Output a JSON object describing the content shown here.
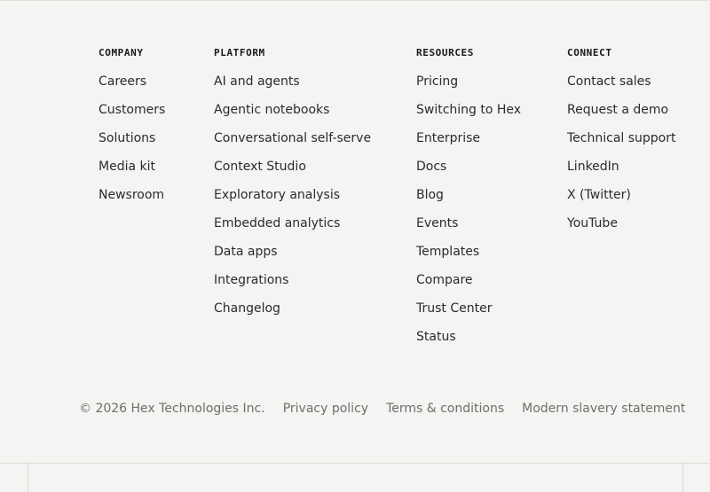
{
  "footer": {
    "columns": [
      {
        "heading": "COMPANY",
        "links": [
          "Careers",
          "Customers",
          "Solutions",
          "Media kit",
          "Newsroom"
        ]
      },
      {
        "heading": "PLATFORM",
        "links": [
          "AI and agents",
          "Agentic notebooks",
          "Conversational self-serve",
          "Context Studio",
          "Exploratory analysis",
          "Embedded analytics",
          "Data apps",
          "Integrations",
          "Changelog"
        ]
      },
      {
        "heading": "RESOURCES",
        "links": [
          "Pricing",
          "Switching to Hex",
          "Enterprise",
          "Docs",
          "Blog",
          "Events",
          "Templates",
          "Compare",
          "Trust Center",
          "Status"
        ]
      },
      {
        "heading": "CONNECT",
        "links": [
          "Contact sales",
          "Request a demo",
          "Technical support",
          "LinkedIn",
          "X (Twitter)",
          "YouTube"
        ]
      }
    ],
    "legal": {
      "copyright": "© 2026 Hex Technologies Inc.",
      "privacy": "Privacy policy",
      "terms": "Terms & conditions",
      "slavery": "Modern slavery statement"
    }
  },
  "colors": {
    "background": "#f5f4f2",
    "heading": "#1a1a1a",
    "link": "#2b2b2b",
    "legal": "#6f6e6b",
    "divider": "#dcdbd8"
  }
}
